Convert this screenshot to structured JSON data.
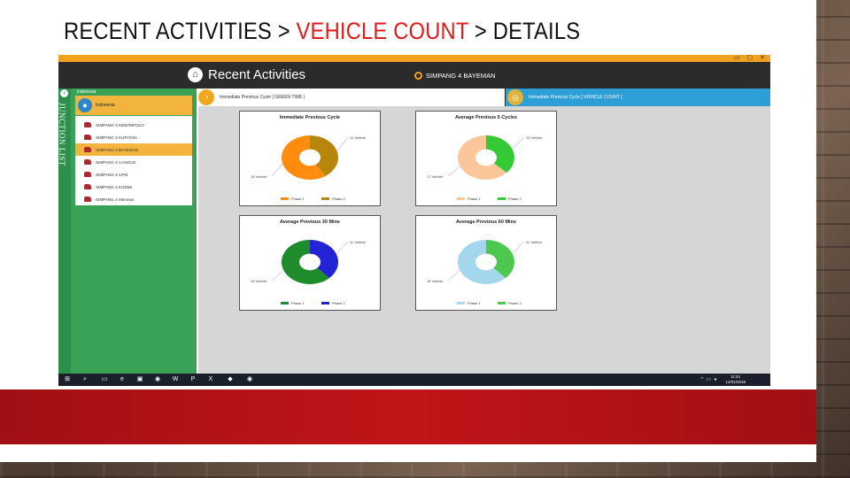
{
  "slide": {
    "title_part1": "RECENT ACTIVITIES > ",
    "title_accent": "VEHICLE COUNT",
    "title_part2": " > DETAILS"
  },
  "app": {
    "window_controls": [
      "▭",
      "▢",
      "✕"
    ],
    "title": "Recent Activities",
    "junction": "SIMPANG 4 BAYEMAN",
    "sidebar": {
      "rail_label": "JUNCTION LIST",
      "country_label": "indonesia",
      "country": "Indonesia",
      "junctions": [
        "SIMPANG 3 KEBONPOLO",
        "SIMPANG 3 KUPATAN",
        "SIMPANG 4 BAYEMAN",
        "SIMPANG 4 CANGUK",
        "SIMPANG 4 CPM",
        "SIMPANG 4 KODIM",
        "SIMPANG 4 Menowo"
      ],
      "selected_index": 2
    },
    "tabs": {
      "green_time": "Immediate Previous Cycle [ GREEN TIME ]",
      "vehicle_count": "Immediate Previous Cycle [ VEHICLE COUNT ]"
    },
    "taskbar": {
      "time": "11:51",
      "date": "14/01/2018"
    }
  },
  "colors": {
    "accent_orange": "#f0a21e",
    "sidebar_green": "#39a257",
    "tab_blue": "#2d9fd6",
    "title_red": "#e01b1b"
  },
  "chart_data": [
    {
      "type": "pie",
      "title": "Immediate Previous Cycle",
      "labels": [
        "Phase 1",
        "Phase 2"
      ],
      "values": [
        16,
        11
      ],
      "data_labels": [
        "16 Vehicle",
        "11 Vehicle"
      ],
      "colors": [
        "#ff8c0f",
        "#b8860b"
      ]
    },
    {
      "type": "pie",
      "title": "Average Previous 5 Cycles",
      "labels": [
        "Phase 1",
        "Phase 2"
      ],
      "values": [
        17,
        10
      ],
      "data_labels": [
        "17 Vehicle",
        "10 Vehicle"
      ],
      "colors": [
        "#fbc79a",
        "#35c935"
      ]
    },
    {
      "type": "pie",
      "title": "Average Previous 30 Mins",
      "labels": [
        "Phase 1",
        "Phase 2"
      ],
      "values": [
        18,
        11
      ],
      "data_labels": [
        "18 Vehicle",
        "11 Vehicle"
      ],
      "colors": [
        "#1e8c2a",
        "#2323d6"
      ]
    },
    {
      "type": "pie",
      "title": "Average Previous 60 Mins",
      "labels": [
        "Phase 1",
        "Phase 2"
      ],
      "values": [
        18,
        11
      ],
      "data_labels": [
        "18 Vehicle",
        "11 Vehicle"
      ],
      "colors": [
        "#a4d7ee",
        "#4cc94c"
      ]
    }
  ]
}
